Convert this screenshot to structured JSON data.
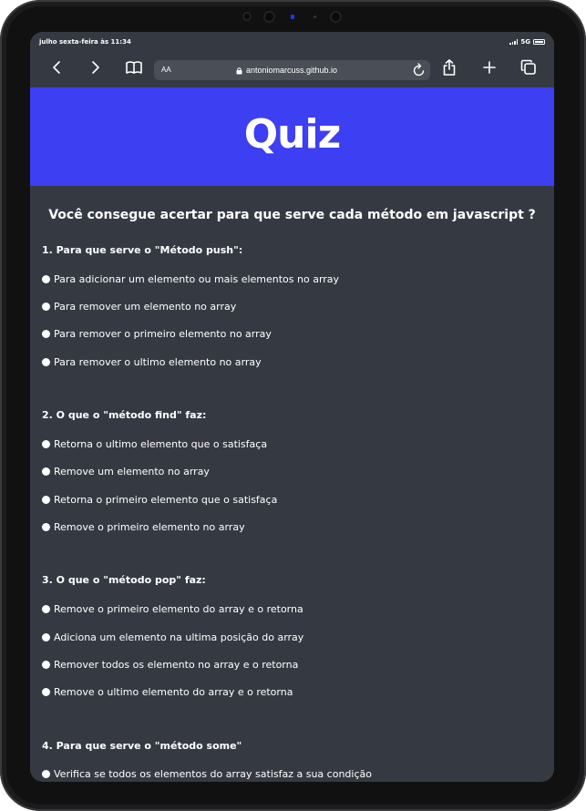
{
  "status_bar": {
    "time": "julho sexta-feira às 11:34",
    "network": "5G"
  },
  "browser": {
    "text_size_label": "AA",
    "url": "antoniomarcuss.github.io"
  },
  "toolbar_icons": [
    "chevron-left-icon",
    "chevron-right-icon",
    "book-icon",
    "lock-icon",
    "reload-icon",
    "share-icon",
    "plus-icon",
    "tabs-icon"
  ],
  "page": {
    "title": "Quiz",
    "subtitle": "Você consegue acertar para que serve cada método em javascript ?",
    "questions": [
      {
        "text": "1. Para que serve o \"Método push\":",
        "options": [
          "Para adicionar um elemento ou mais elementos no array",
          "Para remover um elemento no array",
          "Para remover o primeiro elemento no array",
          "Para remover o ultimo elemento no array"
        ]
      },
      {
        "text": "2. O que o \"método find\" faz:",
        "options": [
          "Retorna o ultimo elemento que o satisfaça",
          "Remove um elemento no array",
          "Retorna o primeiro elemento que o satisfaça",
          "Remove o primeiro elemento no array"
        ]
      },
      {
        "text": "3. O que o \"método pop\" faz:",
        "options": [
          "Remove o primeiro elemento do array e o retorna",
          "Adiciona um elemento na ultima posição do array",
          "Remover todos os elemento no array e o retorna",
          "Remove o ultimo elemento do array e o retorna"
        ]
      },
      {
        "text": "4. Para que serve o \"método some\"",
        "options": [
          "Verifica se todos os elementos do array satisfaz a sua condição"
        ]
      }
    ]
  },
  "colors": {
    "header_bg": "#3d3ff2",
    "page_bg": "#353a42",
    "text": "#ffffff"
  }
}
